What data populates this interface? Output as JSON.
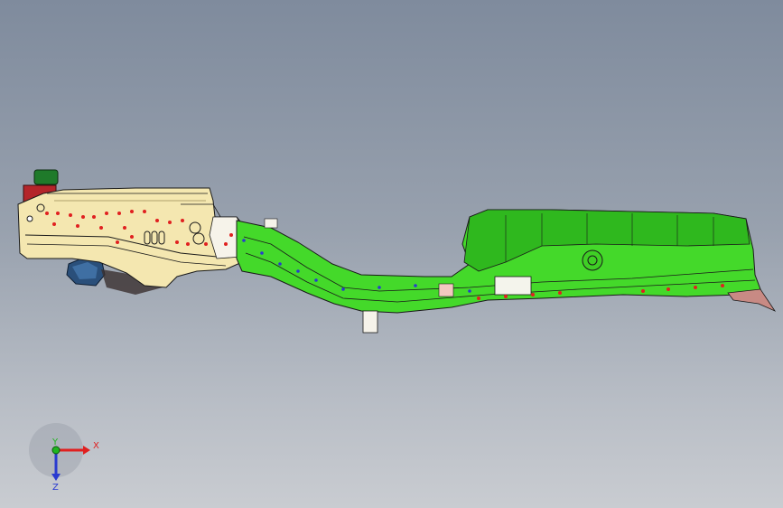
{
  "viewport": {
    "background_top": "#7f8b9d",
    "background_bottom": "#c9ccd1"
  },
  "model": {
    "front_frame_color": "#f4e7b0",
    "rear_frame_color": "#44d92a",
    "edge_color": "#1a1a1a",
    "weld_point_color": "#e02020"
  },
  "axis_triad": {
    "x_label": "X",
    "y_label": "Y",
    "z_label": "Z",
    "x_color": "#e02020",
    "y_color": "#1fb51f",
    "z_color": "#2a3ad0"
  }
}
